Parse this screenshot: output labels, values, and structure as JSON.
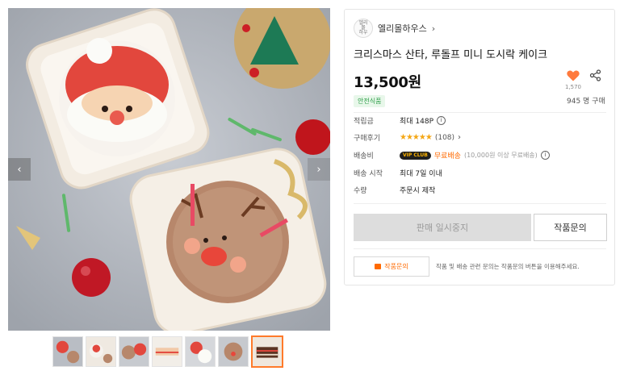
{
  "gallery": {
    "prev_arrow": "‹",
    "next_arrow": "›",
    "thumbnail_count": 7,
    "active_thumbnail_index": 6
  },
  "seller": {
    "logo_text": "엘리\n몰\n하우",
    "name": "엘리몰하우스",
    "chevron": "›"
  },
  "product": {
    "title": "크리스마스 산타, 루돌프 미니 도시락 케이크",
    "price": "13,500원",
    "like_count": "1,570",
    "badge": "안전식품",
    "buyers": "945 명 구매"
  },
  "info": [
    {
      "label": "적립금",
      "value": "최대 148P"
    },
    {
      "label": "구매후기",
      "stars": "★★★★★",
      "value": "(108)"
    },
    {
      "label": "배송비",
      "vip": "VIP CLUB",
      "value": "무료배송",
      "note": "(10,000원 이상 무료배송)"
    },
    {
      "label": "배송 시작",
      "value": "최대 7일 이내"
    },
    {
      "label": "수량",
      "value": "주문시 제작"
    }
  ],
  "actions": {
    "soldout_label": "판매 일시중지",
    "inquiry_label": "작품문의",
    "inquiry_small_label": "작품문의",
    "inquiry_note": "작품 및 배송 관련 문의는 작품문의 버튼을 이용해주세요."
  },
  "colors": {
    "accent": "#ff6a00",
    "star": "#f4a716",
    "heart": "#ff7a3d",
    "safe_green": "#2d9e48"
  }
}
